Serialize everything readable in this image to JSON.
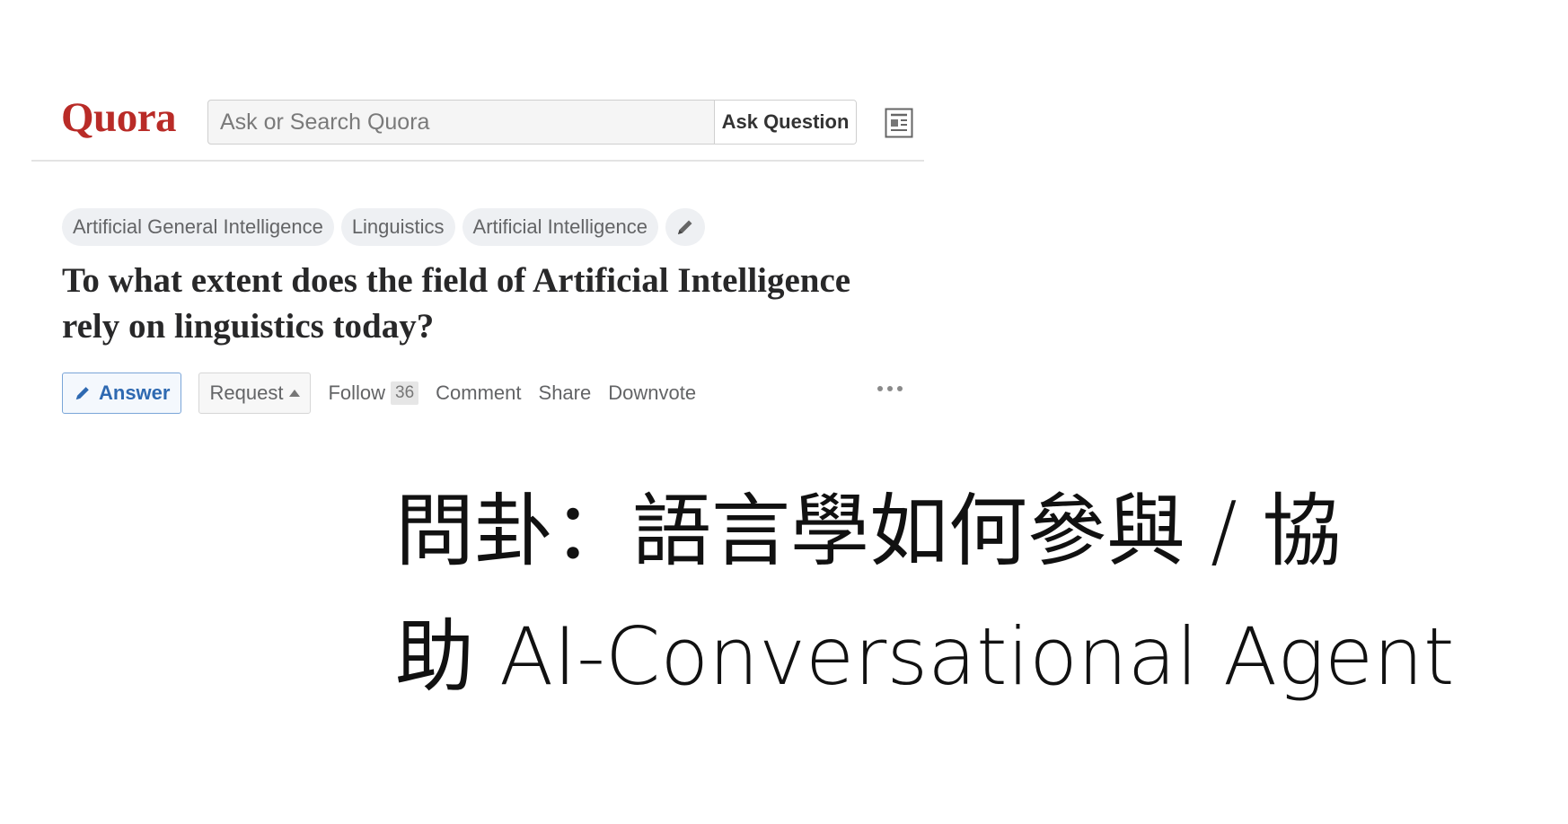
{
  "header": {
    "logo": "Quora",
    "search_placeholder": "Ask or Search Quora",
    "ask_button": "Ask Question",
    "news_icon": "newspaper-icon"
  },
  "question": {
    "topics": [
      "Artificial General Intelligence",
      "Linguistics",
      "Artificial Intelligence"
    ],
    "edit_topics_icon": "pencil-icon",
    "title": "To what extent does the field of Artificial Intelligence rely on linguistics today?"
  },
  "actions": {
    "answer": "Answer",
    "answer_icon": "pencil-icon",
    "request": "Request",
    "follow": "Follow",
    "follow_count": "36",
    "comment": "Comment",
    "share": "Share",
    "downvote": "Downvote",
    "more_icon": "ellipsis-icon"
  },
  "caption": {
    "line1": "問卦：語言學如何參與 / 協",
    "line2": "助 AI-Conversational Agent"
  },
  "colors": {
    "brand": "#b92b27",
    "answer_blue": "#2e69b1",
    "title_text": "#282829",
    "meta_text": "#636466"
  }
}
